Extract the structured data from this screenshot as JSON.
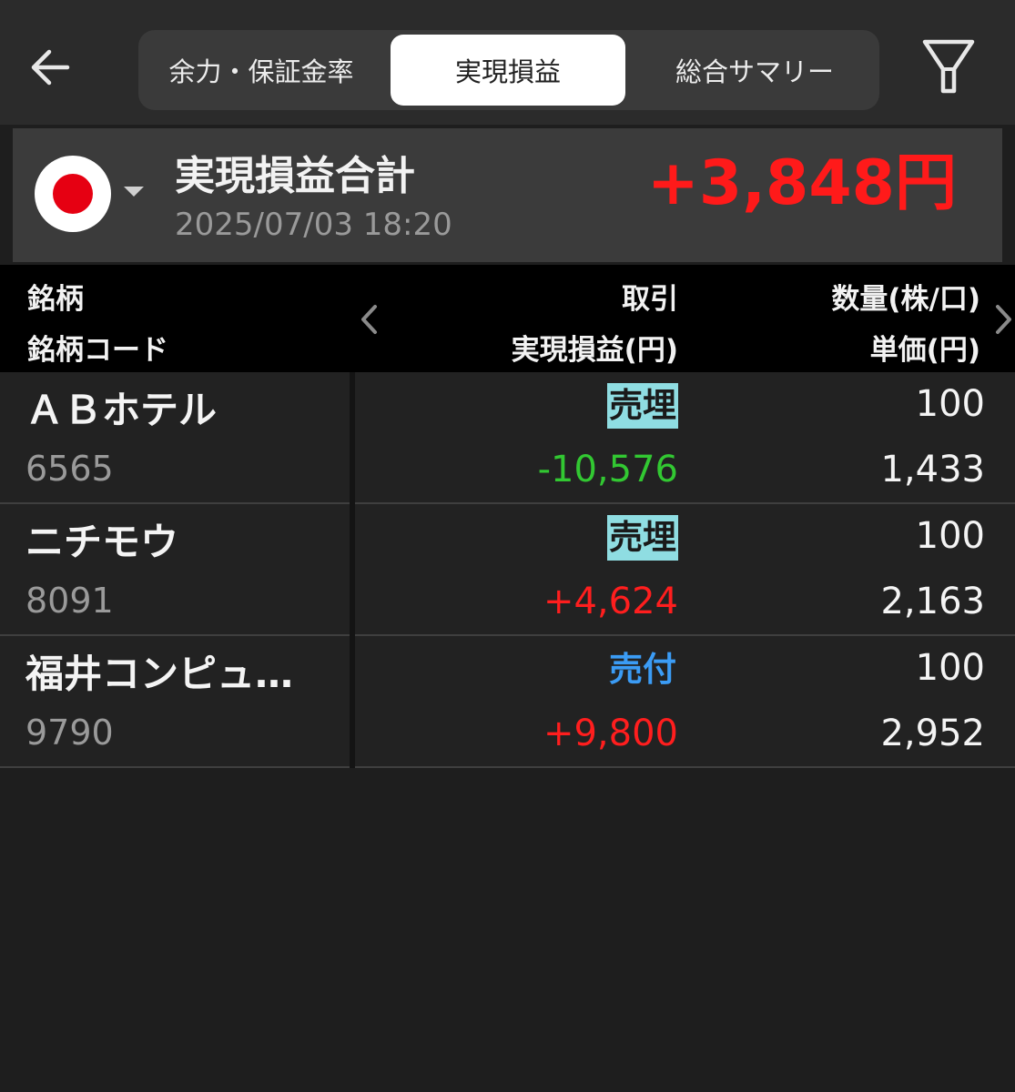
{
  "tabs": [
    {
      "label": "余力・保証金率"
    },
    {
      "label": "実現損益"
    },
    {
      "label": "総合サマリー"
    }
  ],
  "icons": {
    "back": "arrow-left-icon",
    "filter": "filter-icon",
    "flag": "japan-flag-icon",
    "dropdown": "caret-down-icon",
    "prev": "chevron-left-icon",
    "next": "chevron-right-icon"
  },
  "summary": {
    "title": "実現損益合計",
    "date": "2025/07/03 18:20",
    "total": "+3,848円"
  },
  "columns": {
    "name": "銘柄",
    "code": "銘柄コード",
    "trade": "取引",
    "pl": "実現損益(円)",
    "qty": "数量(株/口)",
    "price": "単価(円)"
  },
  "rows": [
    {
      "name": "ＡＢホテル",
      "code": "6565",
      "trade": "売埋",
      "pl": "-10,576",
      "qty": "100",
      "price": "1,433"
    },
    {
      "name": "ニチモウ",
      "code": "8091",
      "trade": "売埋",
      "pl": "+4,624",
      "qty": "100",
      "price": "2,163"
    },
    {
      "name": "福井コンピュ…",
      "code": "9790",
      "trade": "売付",
      "pl": "+9,800",
      "qty": "100",
      "price": "2,952"
    }
  ],
  "colors": {
    "profit": "#ff1e1e",
    "loss": "#32c832",
    "trade_close_bg": "#8fdde2",
    "trade_open": "#3b9cf5"
  }
}
